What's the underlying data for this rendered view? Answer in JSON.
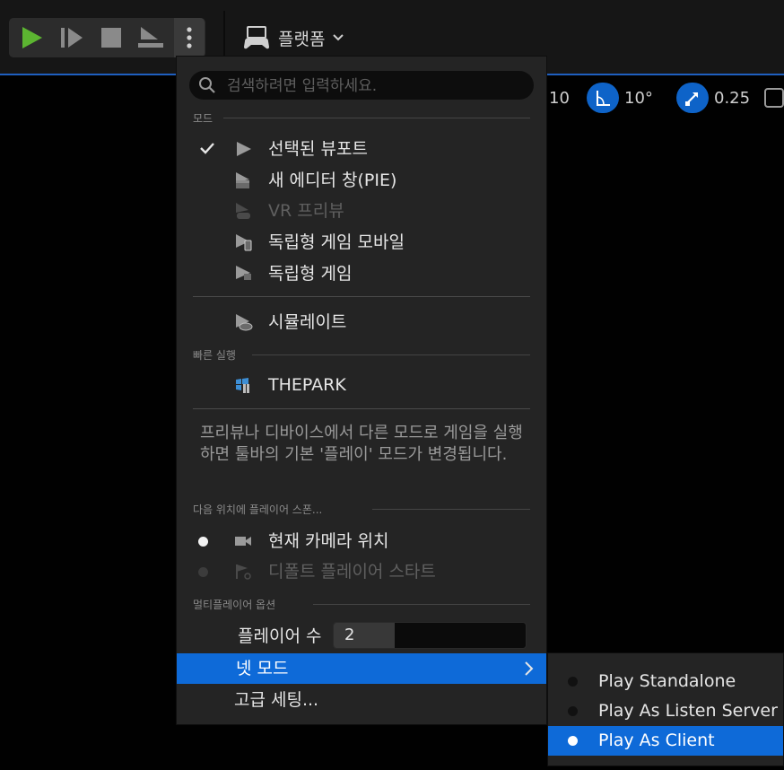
{
  "toolbar": {
    "buttons": [
      "play-icon",
      "advance-frame-icon",
      "stop-icon",
      "eject-icon",
      "more-options-icon"
    ],
    "platform_label": "플랫폼",
    "snap": {
      "grid_value": "10",
      "rotation_value": "10°",
      "scale_value": "0.25"
    }
  },
  "menu": {
    "search_placeholder": "검색하려면 입력하세요.",
    "sections": {
      "mode": "모드",
      "quick_launch": "빠른 실행",
      "spawn_at": "다음 위치에 플레이어 스폰...",
      "multiplayer": "멀티플레이어 옵션"
    },
    "mode_items": [
      {
        "label": "선택된 뷰포트",
        "checked": true,
        "enabled": true
      },
      {
        "label": "새 에디터 창(PIE)",
        "checked": false,
        "enabled": true
      },
      {
        "label": "VR 프리뷰",
        "checked": false,
        "enabled": false
      },
      {
        "label": "독립형 게임 모바일",
        "checked": false,
        "enabled": true
      },
      {
        "label": "독립형 게임",
        "checked": false,
        "enabled": true
      }
    ],
    "simulate_label": "시뮬레이트",
    "quick_launch_item": "THEPARK",
    "info_text": "프리뷰나 디바이스에서 다른 모드로 게임을 실행하면 툴바의 기본 '플레이' 모드가 변경됩니다.",
    "spawn_items": [
      {
        "label": "현재 카메라 위치",
        "selected": true,
        "enabled": true
      },
      {
        "label": "디폴트 플레이어 스타트",
        "selected": false,
        "enabled": false
      }
    ],
    "players_label": "플레이어 수",
    "players_value": "2",
    "net_mode_label": "넷 모드",
    "advanced_label": "고급 세팅..."
  },
  "net_mode_submenu": [
    {
      "label": "Play Standalone",
      "selected": false
    },
    {
      "label": "Play As Listen Server",
      "selected": false
    },
    {
      "label": "Play As Client",
      "selected": true
    }
  ],
  "colors": {
    "accent": "#0e6ad8",
    "play_green": "#5cb531",
    "menu_bg": "#242424",
    "toolbar_bg": "#161616"
  }
}
